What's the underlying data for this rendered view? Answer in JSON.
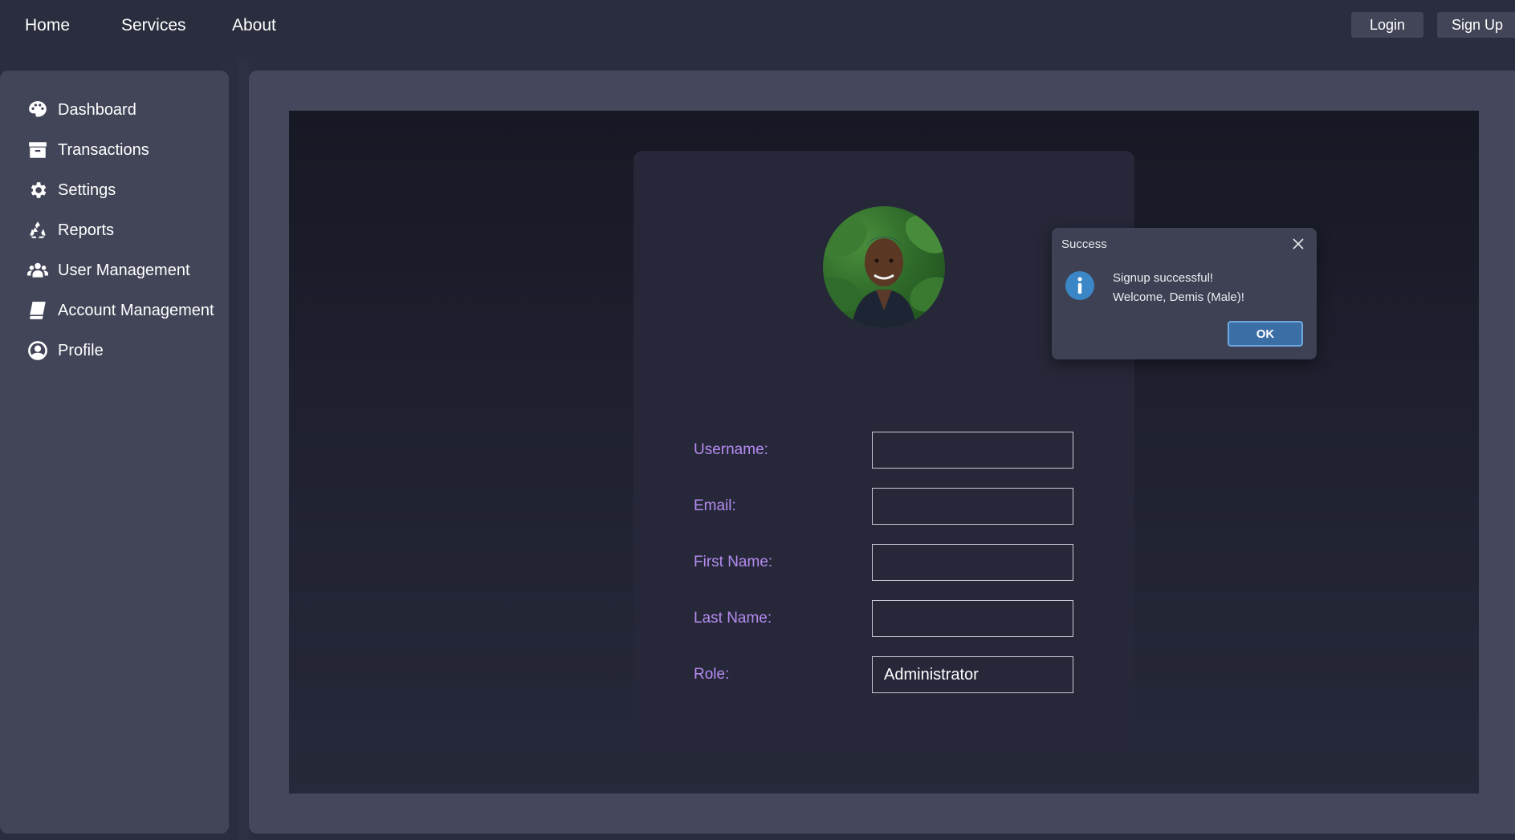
{
  "topnav": {
    "home": "Home",
    "services": "Services",
    "about": "About",
    "login": "Login",
    "signup": "Sign Up"
  },
  "sidebar": {
    "items": [
      {
        "label": "Dashboard",
        "icon": "palette-icon"
      },
      {
        "label": "Transactions",
        "icon": "archive-icon"
      },
      {
        "label": "Settings",
        "icon": "gear-icon"
      },
      {
        "label": "Reports",
        "icon": "recycle-icon"
      },
      {
        "label": "User Management",
        "icon": "users-icon"
      },
      {
        "label": "Account Management",
        "icon": "book-icon"
      },
      {
        "label": "Profile",
        "icon": "user-circle-icon"
      }
    ]
  },
  "form": {
    "username_label": "Username:",
    "username_value": "",
    "email_label": "Email:",
    "email_value": "",
    "first_name_label": "First Name:",
    "first_name_value": "",
    "last_name_label": "Last Name:",
    "last_name_value": "",
    "role_label": "Role:",
    "role_value": "Administrator"
  },
  "dialog": {
    "title": "Success",
    "line1": "Signup successful!",
    "line2": "Welcome, Demis (Male)!",
    "ok_label": "OK"
  },
  "colors": {
    "background": "#2a2d3d",
    "panel": "#45485c",
    "sidebar": "#424558",
    "form_label": "#b58bf0",
    "info_blue": "#3b86c6"
  }
}
